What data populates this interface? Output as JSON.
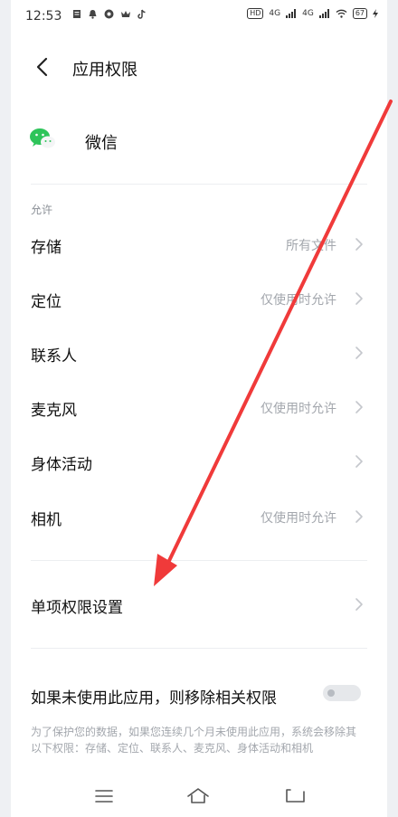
{
  "status_bar": {
    "time": "12:53",
    "left_icons": [
      "message-icon",
      "notification-icon",
      "app-icon",
      "crown-icon",
      "tiktok-icon"
    ],
    "hd_label": "HD",
    "network_1": "4G",
    "network_2": "4G",
    "battery": "67"
  },
  "header": {
    "title": "应用权限"
  },
  "app": {
    "name": "微信"
  },
  "section": {
    "label": "允许"
  },
  "permissions": [
    {
      "label": "存储",
      "value": "所有文件"
    },
    {
      "label": "定位",
      "value": "仅使用时允许"
    },
    {
      "label": "联系人",
      "value": ""
    },
    {
      "label": "麦克风",
      "value": "仅使用时允许"
    },
    {
      "label": "身体活动",
      "value": ""
    },
    {
      "label": "相机",
      "value": "仅使用时允许"
    }
  ],
  "single_permission": {
    "label": "单项权限设置"
  },
  "auto_remove": {
    "label": "如果未使用此应用，则移除相关权限",
    "enabled": false,
    "note": "为了保护您的数据，如果您连续几个月未使用此应用，系统会移除其以下权限：存储、定位、联系人、麦克风、身体活动和相机"
  },
  "colors": {
    "annotation_arrow": "#f03a3a",
    "wechat_green": "#2ec45a",
    "secondary_text": "#a3a7ad"
  },
  "navbar": {
    "icons": [
      "menu-icon",
      "home-icon",
      "back-nav-icon"
    ]
  }
}
